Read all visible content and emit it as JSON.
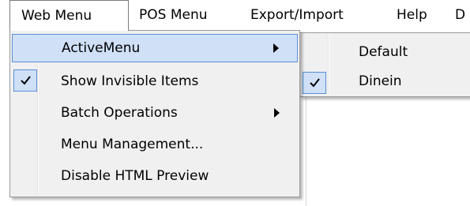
{
  "menubar": {
    "items": [
      {
        "label": "Web Menu"
      },
      {
        "label": "POS Menu"
      },
      {
        "label": "Export/Import"
      },
      {
        "label": "Help"
      },
      {
        "label": "D"
      }
    ]
  },
  "web_menu": {
    "items": [
      {
        "label": "ActiveMenu",
        "checked": false,
        "has_submenu": true,
        "highlighted": true
      },
      {
        "label": "Show Invisible Items",
        "checked": true,
        "has_submenu": false
      },
      {
        "label": "Batch Operations",
        "checked": false,
        "has_submenu": true
      },
      {
        "label": "Menu Management...",
        "checked": false,
        "has_submenu": false
      },
      {
        "label": "Disable HTML Preview",
        "checked": false,
        "has_submenu": false
      }
    ]
  },
  "active_menu_submenu": {
    "items": [
      {
        "label": "Default",
        "checked": false
      },
      {
        "label": "Dinein",
        "checked": true
      }
    ]
  },
  "colors": {
    "highlight_fill": "#cfe0f7",
    "highlight_border": "#5a8fd8",
    "menu_background": "#f0f0f0"
  }
}
